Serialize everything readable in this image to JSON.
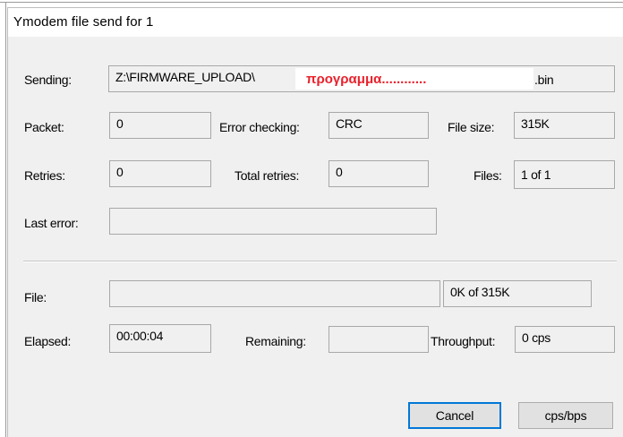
{
  "window": {
    "title": "Ymodem file send for 1"
  },
  "labels": {
    "sending": "Sending:",
    "packet": "Packet:",
    "error_checking": "Error checking:",
    "file_size": "File size:",
    "retries": "Retries:",
    "total_retries": "Total retries:",
    "files": "Files:",
    "last_error": "Last error:",
    "file": "File:",
    "elapsed": "Elapsed:",
    "remaining": "Remaining:",
    "throughput": "Throughput:"
  },
  "values": {
    "sending_path": "Z:\\FIRMWARE_UPLOAD\\",
    "sending_redacted": "προγραμμα............",
    "sending_ext": ".bin",
    "packet": "0",
    "error_checking": "CRC",
    "file_size": "315K",
    "retries": "0",
    "total_retries": "0",
    "files": "1 of 1",
    "last_error": "",
    "file_progress": "",
    "file_progress_text": "0K of 315K",
    "elapsed": "00:00:04",
    "remaining": "",
    "throughput": "0 cps"
  },
  "buttons": {
    "cancel": "Cancel",
    "cps_bps": "cps/bps"
  }
}
